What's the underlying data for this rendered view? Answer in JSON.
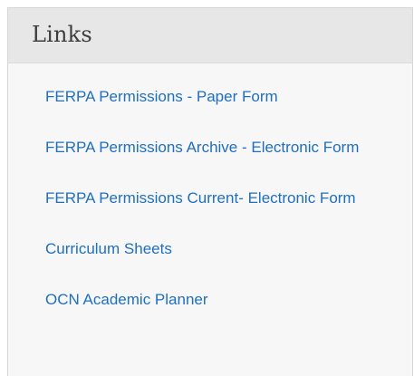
{
  "panel": {
    "title": "Links"
  },
  "links": [
    {
      "label": "FERPA Permissions - Paper Form"
    },
    {
      "label": "FERPA Permissions Archive - Electronic Form"
    },
    {
      "label": "FERPA Permissions Current- Electronic Form"
    },
    {
      "label": "Curriculum Sheets"
    },
    {
      "label": "OCN Academic Planner"
    }
  ],
  "colors": {
    "link": "#1f6fbf",
    "header_bg": "#e7e7e7",
    "panel_bg": "#f7f7f7",
    "title": "#3d3d3d"
  }
}
